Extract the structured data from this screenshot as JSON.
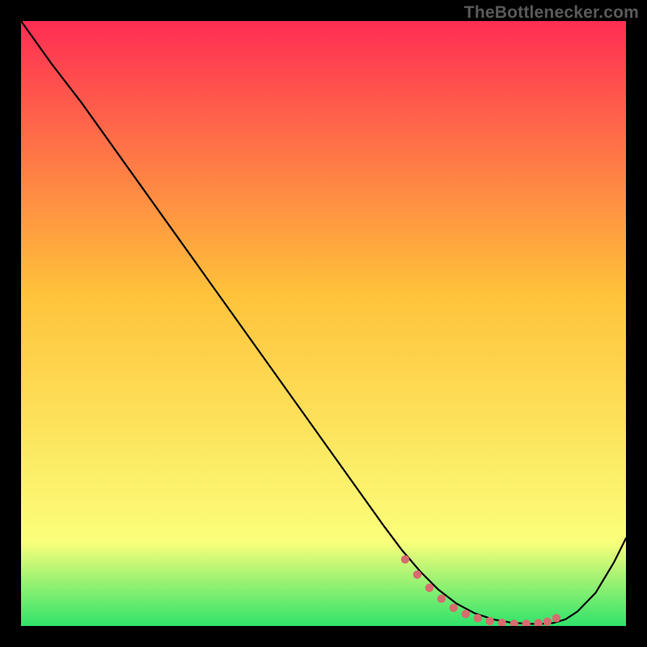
{
  "watermark": "TheBottlenecker.com",
  "colors": {
    "gradient_top": "#ff2d53",
    "gradient_mid": "#ffc23a",
    "gradient_low": "#fbff7a",
    "gradient_bottom": "#2fe36b",
    "background": "#000000",
    "curve": "#000000",
    "marker": "#d86b6f"
  },
  "chart_data": {
    "type": "line",
    "title": "",
    "xlabel": "",
    "ylabel": "",
    "xlim": [
      0,
      100
    ],
    "ylim": [
      0,
      100
    ],
    "grid": false,
    "legend": false,
    "series": [
      {
        "name": "bottleneck-curve",
        "x": [
          0,
          5,
          10,
          15,
          20,
          25,
          30,
          35,
          40,
          45,
          50,
          55,
          60,
          63,
          66,
          69,
          72,
          75,
          78,
          81,
          84,
          86,
          88,
          90,
          92,
          95,
          98,
          100
        ],
        "y": [
          100,
          93,
          86.5,
          79.5,
          72.5,
          65.5,
          58.5,
          51.5,
          44.5,
          37.5,
          30.5,
          23.5,
          16.5,
          12.5,
          9.0,
          6.0,
          3.7,
          2.1,
          1.1,
          0.55,
          0.35,
          0.35,
          0.5,
          1.1,
          2.4,
          5.5,
          10.5,
          14.5
        ]
      }
    ],
    "markers": {
      "name": "minimum-band",
      "x": [
        63.5,
        65.5,
        67.5,
        69.5,
        71.5,
        73.5,
        75.5,
        77.5,
        79.5,
        81.5,
        83.5,
        85.5,
        87.0,
        88.5
      ],
      "y": [
        11.0,
        8.5,
        6.3,
        4.5,
        3.0,
        2.0,
        1.3,
        0.8,
        0.5,
        0.35,
        0.35,
        0.45,
        0.7,
        1.3
      ]
    }
  }
}
